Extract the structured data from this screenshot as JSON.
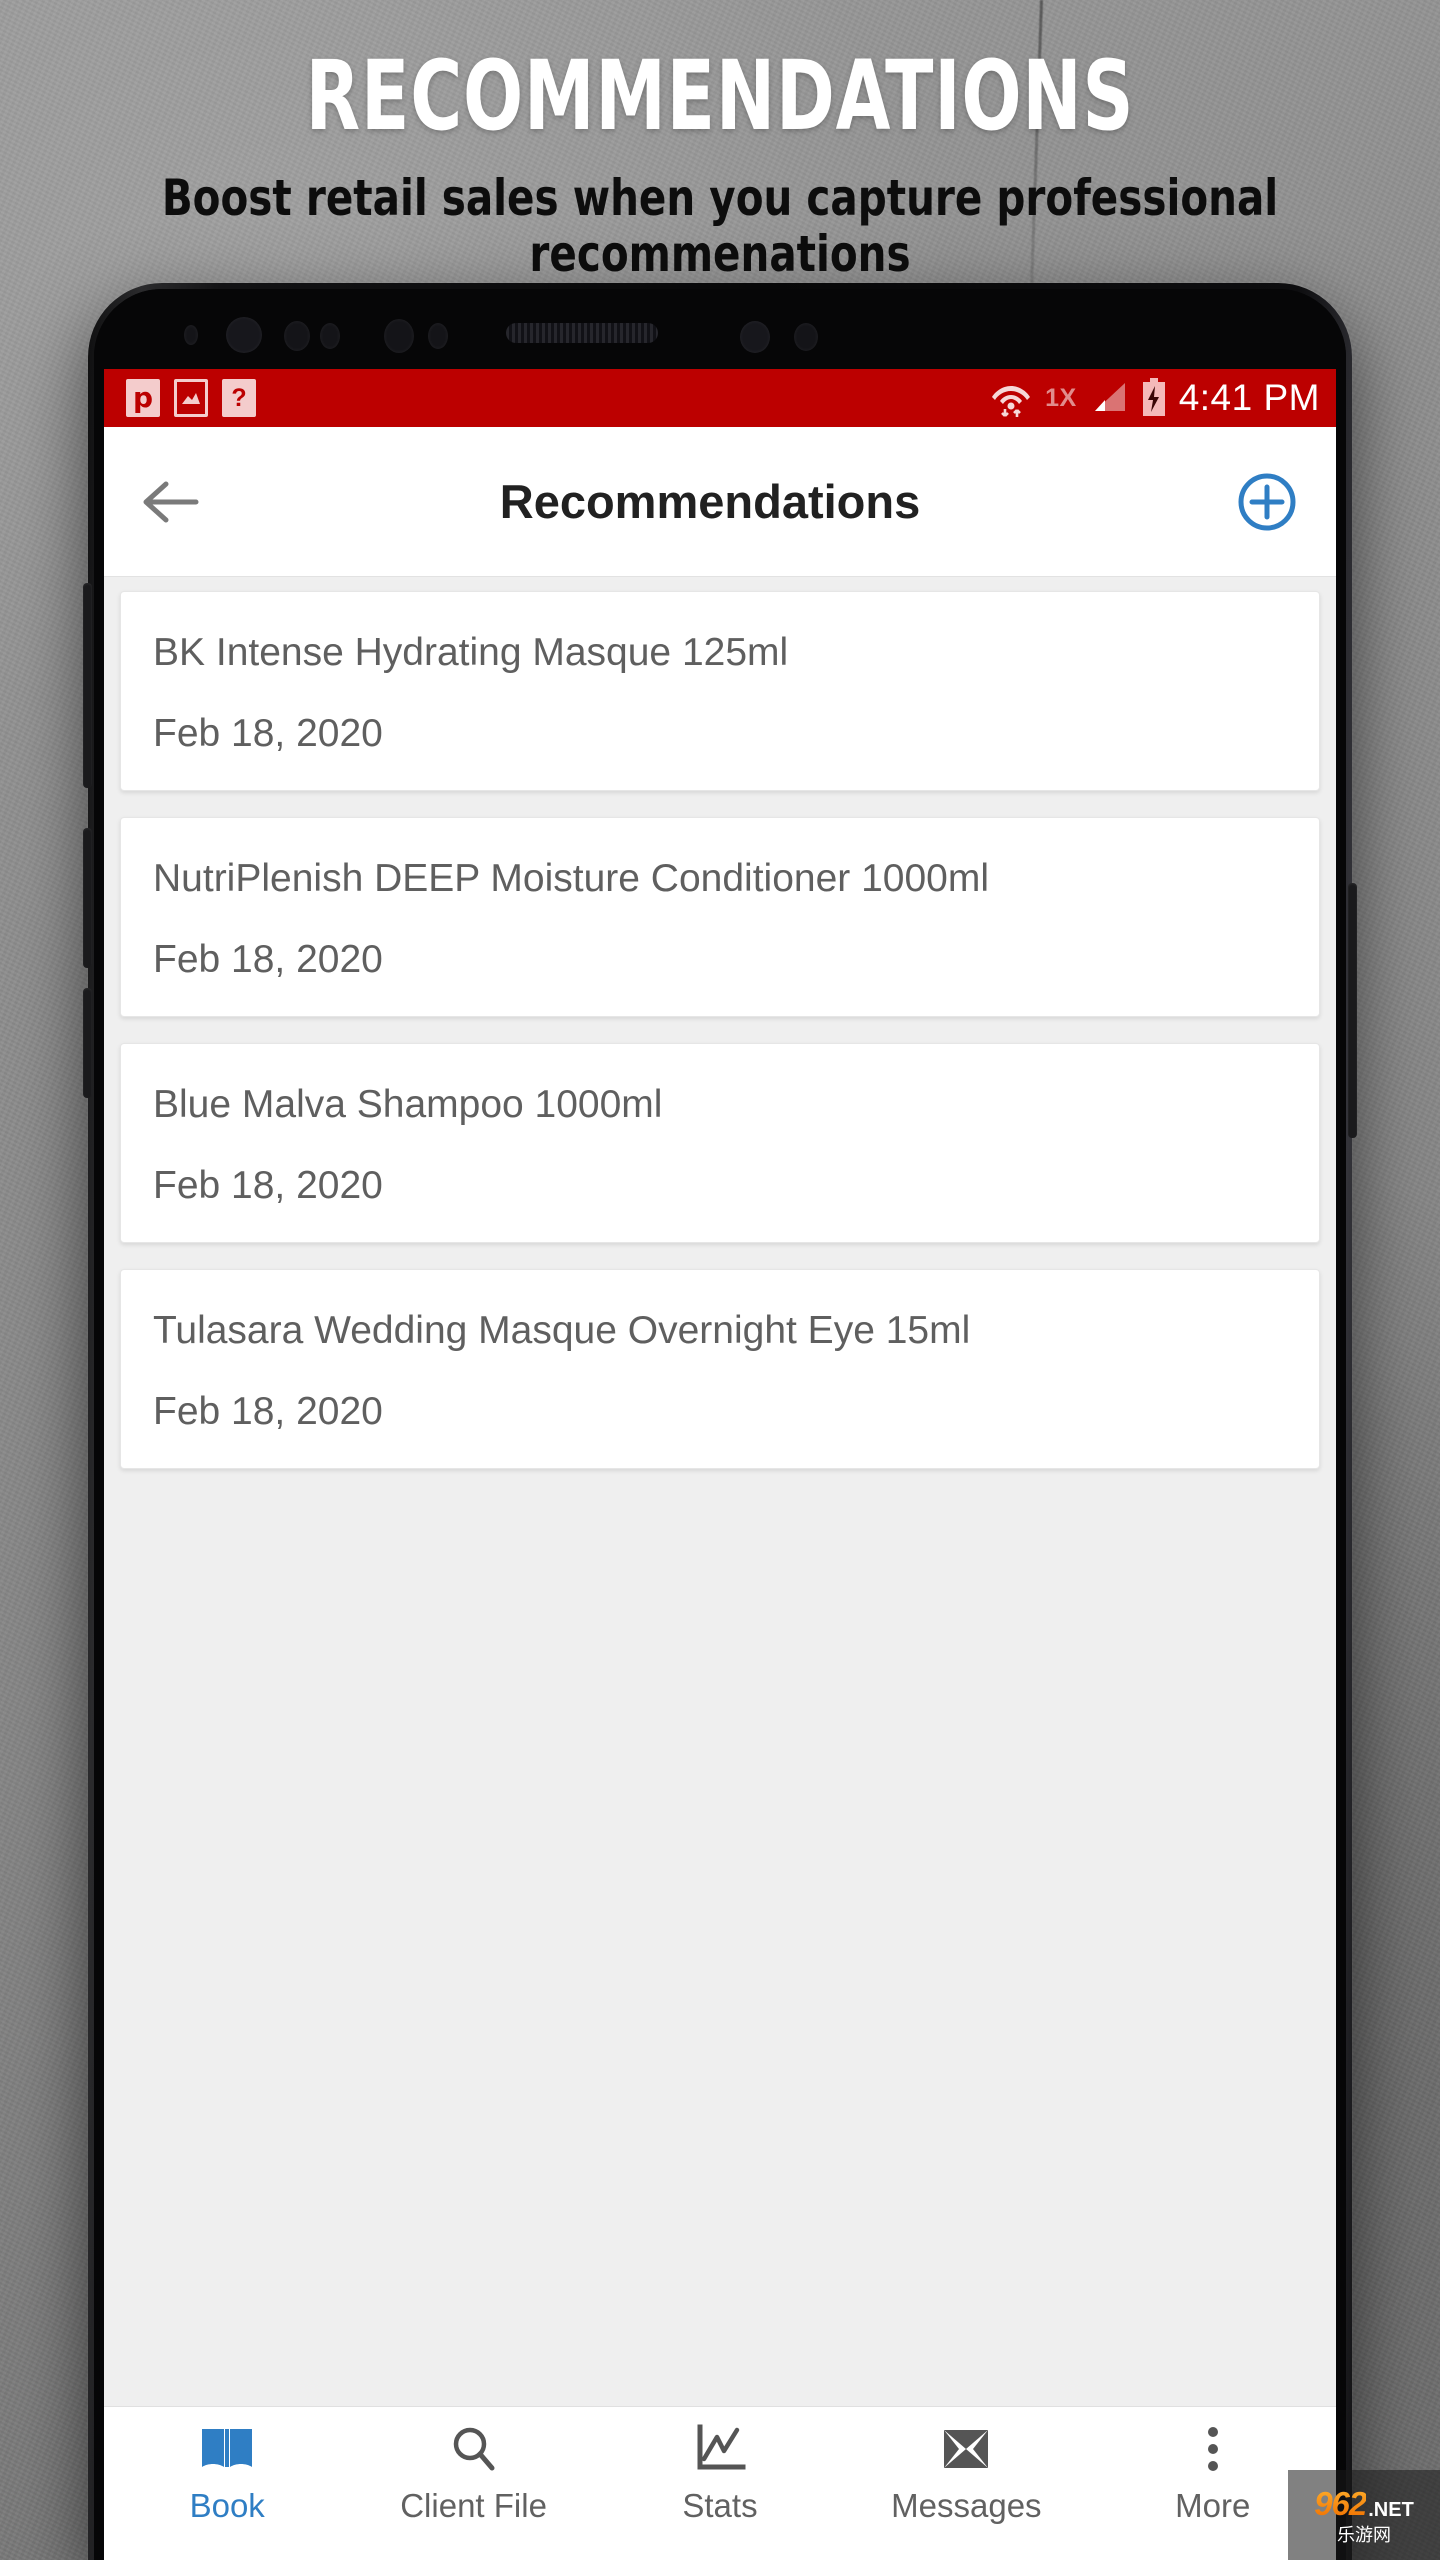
{
  "hero": {
    "title": "RECOMMENDATIONS",
    "subtitle": "Boost retail sales when you capture professional recommenations"
  },
  "status_bar": {
    "notification_icons": [
      "p",
      "▣",
      "?"
    ],
    "network_label": "1X",
    "time": "4:41 PM",
    "background_color": "#bc0000"
  },
  "app_bar": {
    "title": "Recommendations",
    "back_label": "←",
    "add_label": "+",
    "accent_color": "#2f7ec4"
  },
  "recommendations": [
    {
      "name": "BK Intense Hydrating Masque 125ml",
      "date": "Feb 18, 2020"
    },
    {
      "name": "NutriPlenish DEEP Moisture Conditioner 1000ml",
      "date": "Feb 18, 2020"
    },
    {
      "name": "Blue Malva Shampoo 1000ml",
      "date": "Feb 18, 2020"
    },
    {
      "name": "Tulasara Wedding Masque Overnight Eye 15ml",
      "date": "Feb 18, 2020"
    }
  ],
  "bottom_nav": {
    "active_index": 0,
    "items": [
      {
        "label": "Book",
        "icon": "open-book-icon"
      },
      {
        "label": "Client File",
        "icon": "search-icon"
      },
      {
        "label": "Stats",
        "icon": "line-chart-icon"
      },
      {
        "label": "Messages",
        "icon": "envelope-icon"
      },
      {
        "label": "More",
        "icon": "overflow-menu-icon"
      }
    ]
  },
  "watermark": {
    "number": "962",
    "domain": ".NET",
    "subtext": "乐游网"
  }
}
